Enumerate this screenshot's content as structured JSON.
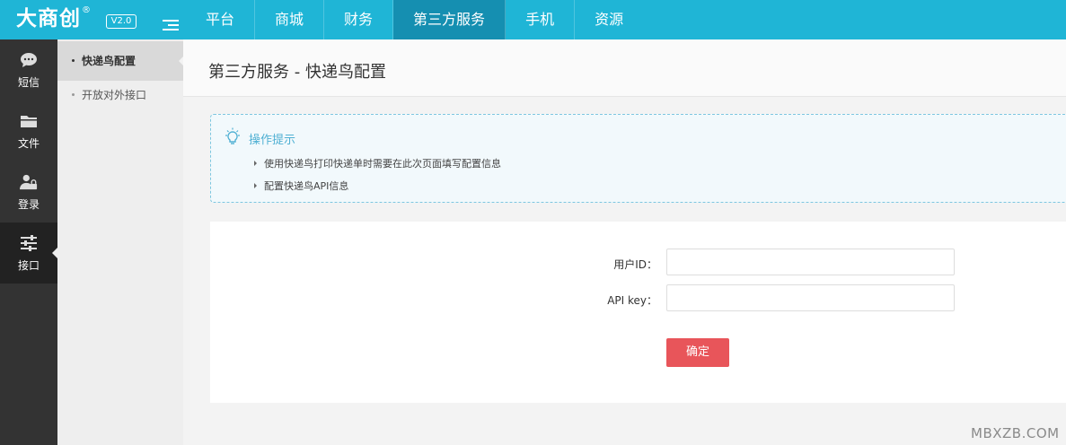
{
  "header": {
    "logo_text": "大商创",
    "logo_reg": "®",
    "version": "V2.0",
    "nav": [
      "平台",
      "商城",
      "财务",
      "第三方服务",
      "手机",
      "资源"
    ],
    "active_nav": "第三方服务"
  },
  "sidebar": {
    "items": [
      {
        "label": "短信",
        "icon": "message-icon"
      },
      {
        "label": "文件",
        "icon": "folder-icon"
      },
      {
        "label": "登录",
        "icon": "user-lock-icon"
      },
      {
        "label": "接口",
        "icon": "sliders-icon"
      }
    ],
    "active": "接口"
  },
  "submenu": {
    "items": [
      "快递鸟配置",
      "开放对外接口"
    ],
    "active": "快递鸟配置"
  },
  "main": {
    "title": "第三方服务 - 快递鸟配置",
    "tips": {
      "title": "操作提示",
      "lines": [
        "使用快递鸟打印快递单时需要在此次页面填写配置信息",
        "配置快递鸟API信息"
      ]
    },
    "form": {
      "user_id_label": "用户ID：",
      "api_key_label": "API key：",
      "user_id_value": "",
      "api_key_value": "",
      "submit_label": "确定"
    }
  },
  "watermark": "MBXZB.COM",
  "colors": {
    "topbar": "#1fb5d6",
    "active_nav": "#158fb1",
    "sidebar": "#333333",
    "submit": "#e8555a",
    "tips_accent": "#4fb0d3"
  }
}
